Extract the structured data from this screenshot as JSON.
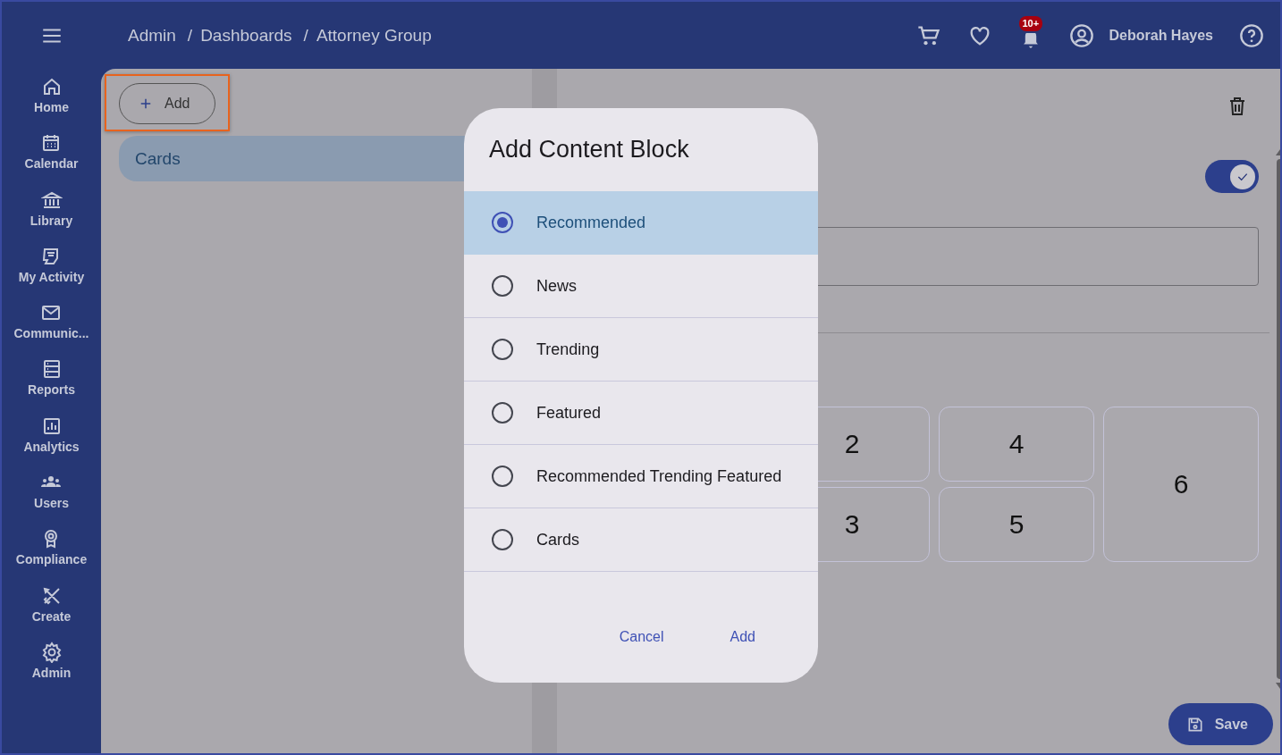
{
  "top_bar": {
    "breadcrumb": [
      {
        "kind": "link",
        "text": "Admin"
      },
      {
        "kind": "separator",
        "text": "/"
      },
      {
        "kind": "link",
        "text": "Dashboards"
      },
      {
        "kind": "separator",
        "text": "/"
      },
      {
        "kind": "current",
        "text": "Attorney Group"
      }
    ],
    "notification_badge": "10+",
    "user_name": "Deborah Hayes"
  },
  "sidebar": {
    "items": [
      {
        "label": "Home"
      },
      {
        "label": "Calendar"
      },
      {
        "label": "Library"
      },
      {
        "label": "My Activity"
      },
      {
        "label": "Communic..."
      },
      {
        "label": "Reports"
      },
      {
        "label": "Analytics"
      },
      {
        "label": "Users"
      },
      {
        "label": "Compliance"
      },
      {
        "label": "Create"
      },
      {
        "label": "Admin"
      }
    ]
  },
  "left_panel": {
    "add_button": {
      "label": "Add",
      "highlighted": true
    },
    "blocks": [
      {
        "label": "Cards",
        "selected": true
      }
    ]
  },
  "right_panel": {
    "toggle": {
      "on": true
    },
    "tiles": [
      {
        "label": "2"
      },
      {
        "label": "3"
      },
      {
        "label": "4"
      },
      {
        "label": "5"
      },
      {
        "label": "6"
      }
    ],
    "save_button": "Save"
  },
  "dialog": {
    "title": "Add Content Block",
    "options": [
      {
        "label": "Recommended",
        "selected": true
      },
      {
        "label": "News",
        "selected": false
      },
      {
        "label": "Trending",
        "selected": false
      },
      {
        "label": "Featured",
        "selected": false
      },
      {
        "label": "Recommended Trending Featured",
        "selected": false
      },
      {
        "label": "Cards",
        "selected": false
      }
    ],
    "buttons": [
      "Cancel",
      "Add"
    ]
  }
}
